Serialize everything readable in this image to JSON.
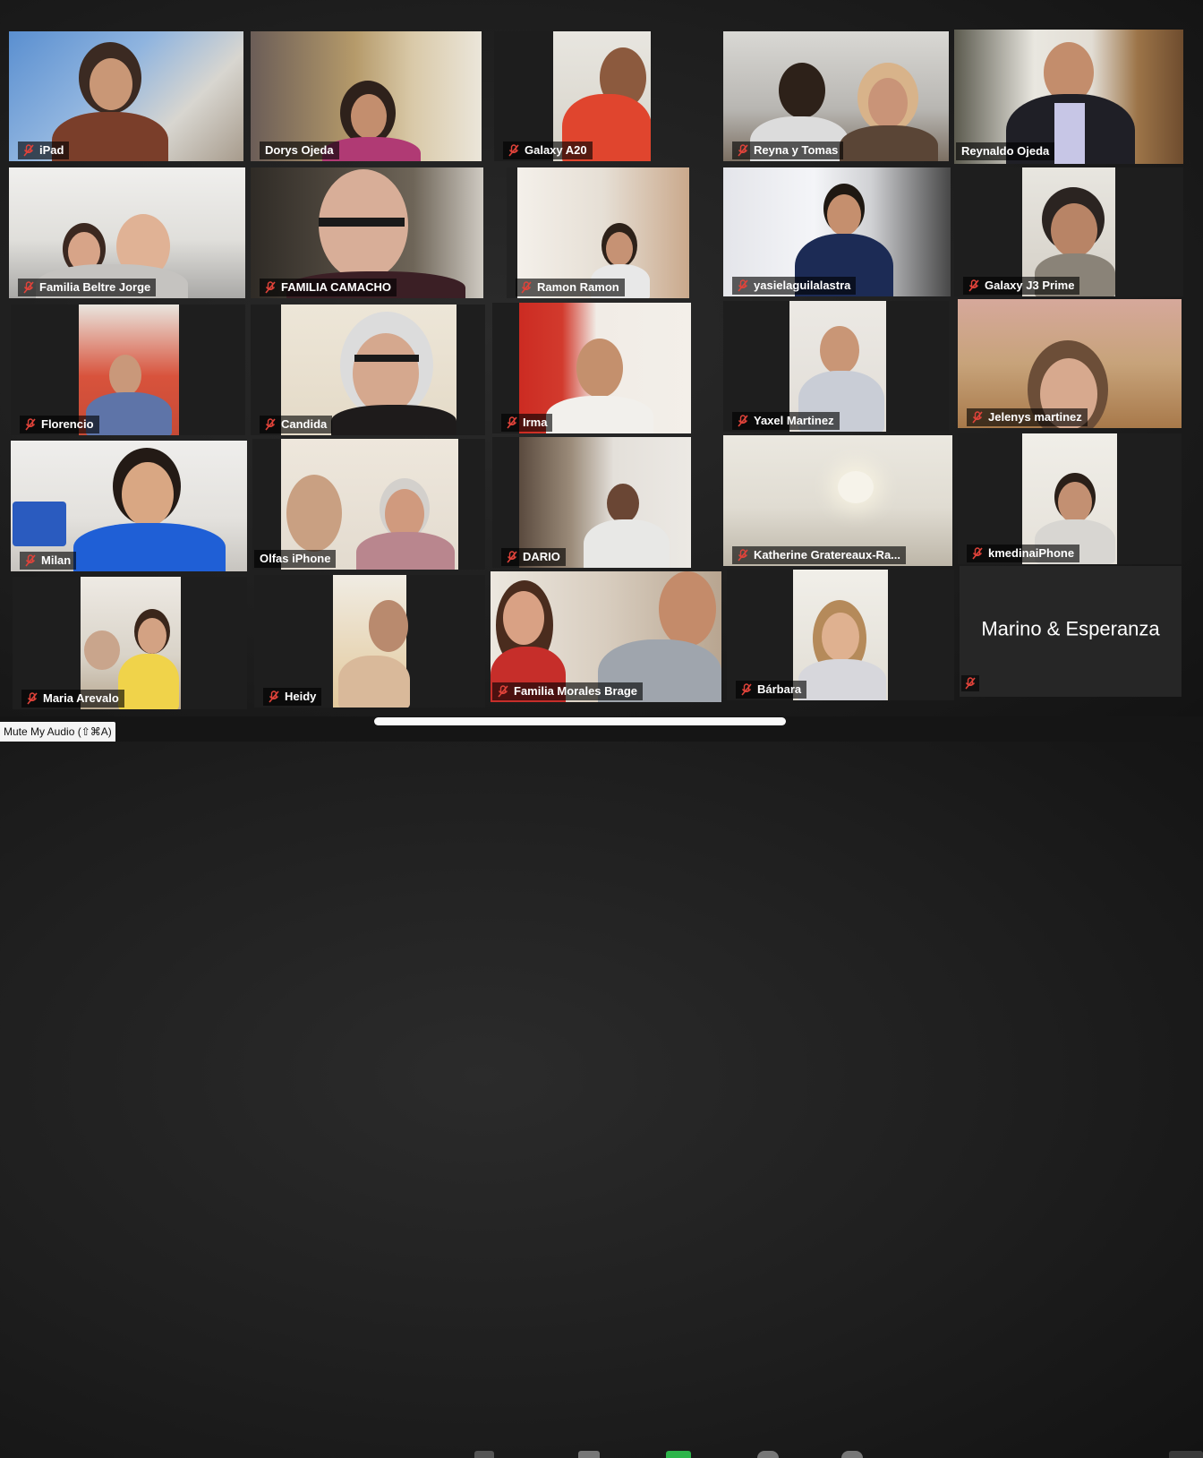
{
  "participants": [
    {
      "name": "iPad"
    },
    {
      "name": "Dorys Ojeda"
    },
    {
      "name": "Galaxy A20"
    },
    {
      "name": "Reyna y Tomas"
    },
    {
      "name": "Reynaldo Ojeda"
    },
    {
      "name": "Familia Beltre Jorge"
    },
    {
      "name": "FAMILIA CAMACHO"
    },
    {
      "name": "Ramon Ramon"
    },
    {
      "name": "yasielaguilalastra"
    },
    {
      "name": "Galaxy J3 Prime"
    },
    {
      "name": "Florencio"
    },
    {
      "name": "Candida"
    },
    {
      "name": "Irma"
    },
    {
      "name": "Yaxel Martinez"
    },
    {
      "name": "Jelenys martinez"
    },
    {
      "name": "Milan"
    },
    {
      "name": "Olfas iPhone"
    },
    {
      "name": "DARIO"
    },
    {
      "name": "Katherine Gratereaux-Ra..."
    },
    {
      "name": "kmedinaiPhone"
    },
    {
      "name": "Maria Arevalo"
    },
    {
      "name": "Heidy"
    },
    {
      "name": "Familia Morales Brage"
    },
    {
      "name": "Bárbara"
    },
    {
      "name": "Marino & Esperanza"
    }
  ],
  "active_speaker_color": "#c8e64a",
  "muted_icon_color": "#e0433a",
  "toolbar": {
    "mute_tooltip": "Mute My Audio (⇧⌘A)"
  }
}
